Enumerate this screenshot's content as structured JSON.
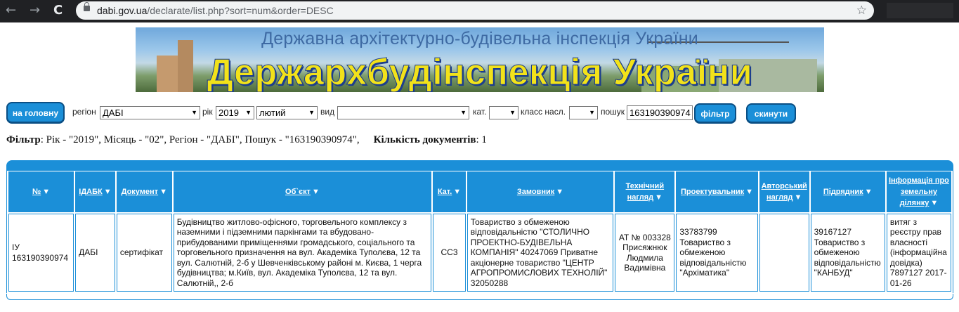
{
  "browser": {
    "url_host": "dabi.gov.ua",
    "url_path": "/declarate/list.php?sort=num&order=DESC",
    "back_glyph": "←",
    "forward_glyph": "→",
    "reload_glyph": "C",
    "star_glyph": "☆"
  },
  "banner": {
    "subtitle": "Державна архітектурно-будівельна інспекція України",
    "title": "Держархбудінспекція України"
  },
  "controls": {
    "home_button": "на головну",
    "region_label": "регіон",
    "region_value": "ДАБІ",
    "year_label": "рік",
    "year_value": "2019",
    "month_value": "лютий",
    "type_label": "вид",
    "type_value": "",
    "category_label": "кат.",
    "category_value": "",
    "class_label": "класс насл.",
    "class_value": "",
    "search_label": "пошук",
    "search_value": "163190390974",
    "filter_button": "фільтр",
    "reset_button": "скинути"
  },
  "filter_summary": {
    "filter_word": "Фільтр",
    "filter_text": ": Рік - \"2019\", Місяць - \"02\", Регіон - \"ДАБІ\", Пошук - \"163190390974\",",
    "count_label": "Кількість документів",
    "count_value": ": 1"
  },
  "table": {
    "headers": [
      "№",
      "ІДАБК",
      "Документ",
      "Об`єкт",
      "Кат.",
      "Замовник",
      "Технічний нагляд",
      "Проектувальник",
      "Авторський нагляд",
      "Підрядник",
      "Інформація про земельну ділянку"
    ],
    "sort_glyph": "▼",
    "row": {
      "num": "ІУ 163190390974",
      "idabk": "ДАБІ",
      "document": "сертифікат",
      "object": "Будівництво житлово-офісного, торговельного комплексу з наземними і підземними паркінгами та вбудовано-прибудованими приміщеннями громадського, соціального та торговельного призначення на вул. Академіка Туполєва, 12 та вул. Салютній, 2-б у Шевченківському районі м. Києва, 1 черга будівництва; м.Київ, вул. Академіка Туполєва, 12 та вул. Салютній,, 2-б",
      "category": "СС3",
      "customer": "Товариство з обмеженою відповідальністю \"СТОЛИЧНО ПРОЕКТНО-БУДІВЕЛЬНА КОМПАНІЯ\" 40247069 Приватне акціонерне товариство \"ЦЕНТР АГРОПРОМИСЛОВИХ ТЕХНОЛІЙ\" 32050288",
      "tech_supervision": "АТ № 003328 Присяжнюк Людмила Вадимівна",
      "designer": "33783799 Товариство з обмеженою відповідальністю \"Архіматика\"",
      "author_supervision": "",
      "contractor": "39167127 Товариство з обмеженою відповідальністю \"КАНБУД\"",
      "land_info": "витяг з реєстру прав власності (інформаційна довідка) 7897127 2017-01-26"
    }
  }
}
